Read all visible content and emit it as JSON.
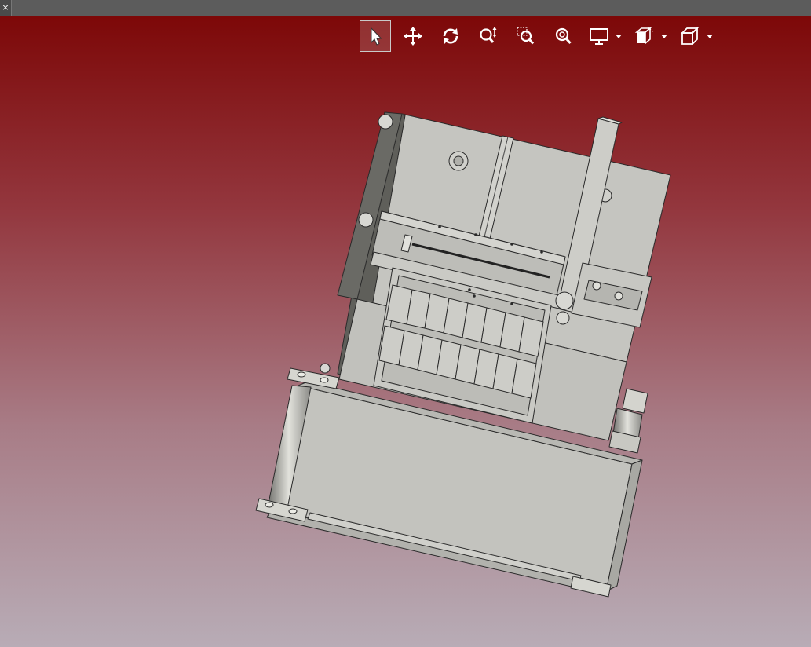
{
  "window": {
    "close_glyph": "×"
  },
  "toolbar": {
    "tools": [
      {
        "name": "select-icon",
        "state": "active"
      },
      {
        "name": "pan-icon"
      },
      {
        "name": "rotate-icon"
      },
      {
        "name": "zoom-icon"
      },
      {
        "name": "zoom-window-icon"
      },
      {
        "name": "zoom-fit-icon"
      },
      {
        "name": "display-style-icon",
        "dropdown": true
      },
      {
        "name": "section-view-icon",
        "dropdown": true
      },
      {
        "name": "view-orientation-icon",
        "dropdown": true
      }
    ]
  },
  "viewport": {
    "background_top": "#7d0808",
    "background_bottom": "#b8acb6",
    "model": "machine-assembly"
  }
}
